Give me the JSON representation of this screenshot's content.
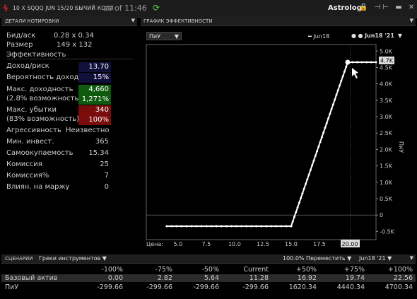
{
  "titlebar": {
    "title": "10 X SQQQ JUN 15/20 БЫЧИЙ КОЛЛ",
    "asof": "as of 11:46",
    "account": "Astrolog",
    "icons": "🔒 ⊣⊢ ▬ ✕"
  },
  "left_panel": {
    "header": "ДЕТАЛИ КОТИРОВКИ",
    "bid_ask_label": "Бид/аск",
    "bid_ask_value": "0.28 x 0.34",
    "size_label": "Размер",
    "size_value": "149 x 132",
    "section_title": "Эффективность",
    "rows": [
      {
        "label": "Доход/риск",
        "value": "13.70"
      },
      {
        "label": "Вероятность дохода",
        "value": "15%"
      },
      {
        "label": "Макс. доходность",
        "label2": "(2.8% возможность)",
        "value": "4,660",
        "value2": "1,271%"
      },
      {
        "label": "Макс. убытки",
        "label2": "(83% возможность)",
        "value": "340",
        "value2": "100%"
      },
      {
        "label": "Агрессивность",
        "value": "Неизвестно"
      },
      {
        "label": "Мин. инвест.",
        "value": "365"
      },
      {
        "label": "Самоокупаемость",
        "value": "15.34"
      },
      {
        "label": "Комиссия",
        "value": "25"
      },
      {
        "label": "Комиссия%",
        "value": "7"
      },
      {
        "label": "Влиян. на маржу",
        "value": "0"
      }
    ]
  },
  "right_panel": {
    "header": "ГРАФИК ЭФФЕКТИВНОСТИ",
    "metric_select": "ПиУ",
    "legend_label": "Jun18",
    "date_select": "Jun18 '21",
    "price_label": "Цена:",
    "y_axis_label": "ПиУ",
    "current_price": "20.00",
    "highlight_value": "4.7K"
  },
  "chart_data": {
    "type": "line",
    "x_ticks": [
      "5.0",
      "7.5",
      "10.0",
      "12.5",
      "15.0",
      "17.5",
      "20.00"
    ],
    "y_ticks": [
      "5.0K",
      "4.5K",
      "4.0K",
      "3.5K",
      "3.0K",
      "2.5K",
      "2.0K",
      "1.5K",
      "1.0K",
      "0.5K",
      "0",
      "-0.5K"
    ],
    "xlim": [
      2.2,
      22.5
    ],
    "ylim": [
      -0.75,
      5.2
    ],
    "series": [
      {
        "name": "Jun18",
        "points": [
          [
            4.0,
            -0.34
          ],
          [
            15.0,
            -0.34
          ],
          [
            20.0,
            4.66
          ],
          [
            22.5,
            4.66
          ]
        ]
      }
    ],
    "colors": {
      "line": "#ffffff",
      "zero_line": "#888888"
    }
  },
  "bottom": {
    "scenarios_label": "СЦЕНАРИИ",
    "instrument_select": "Греки инструментов",
    "move_select": "100.0% Переместить",
    "date_select": "Jun18 '21",
    "columns": [
      "-100%",
      "-75%",
      "-50%",
      "Current",
      "+50%",
      "+75%",
      "+100%"
    ],
    "rows": [
      {
        "label": "Базовый актив",
        "values": [
          "0.00",
          "2.82",
          "5.64",
          "11.28",
          "16.92",
          "19.74",
          "22.56"
        ]
      },
      {
        "label": "ПиУ",
        "values": [
          "-299.66",
          "-299.66",
          "-299.66",
          "-299.66",
          "1620.34",
          "4440.34",
          "4700.34"
        ]
      }
    ]
  }
}
